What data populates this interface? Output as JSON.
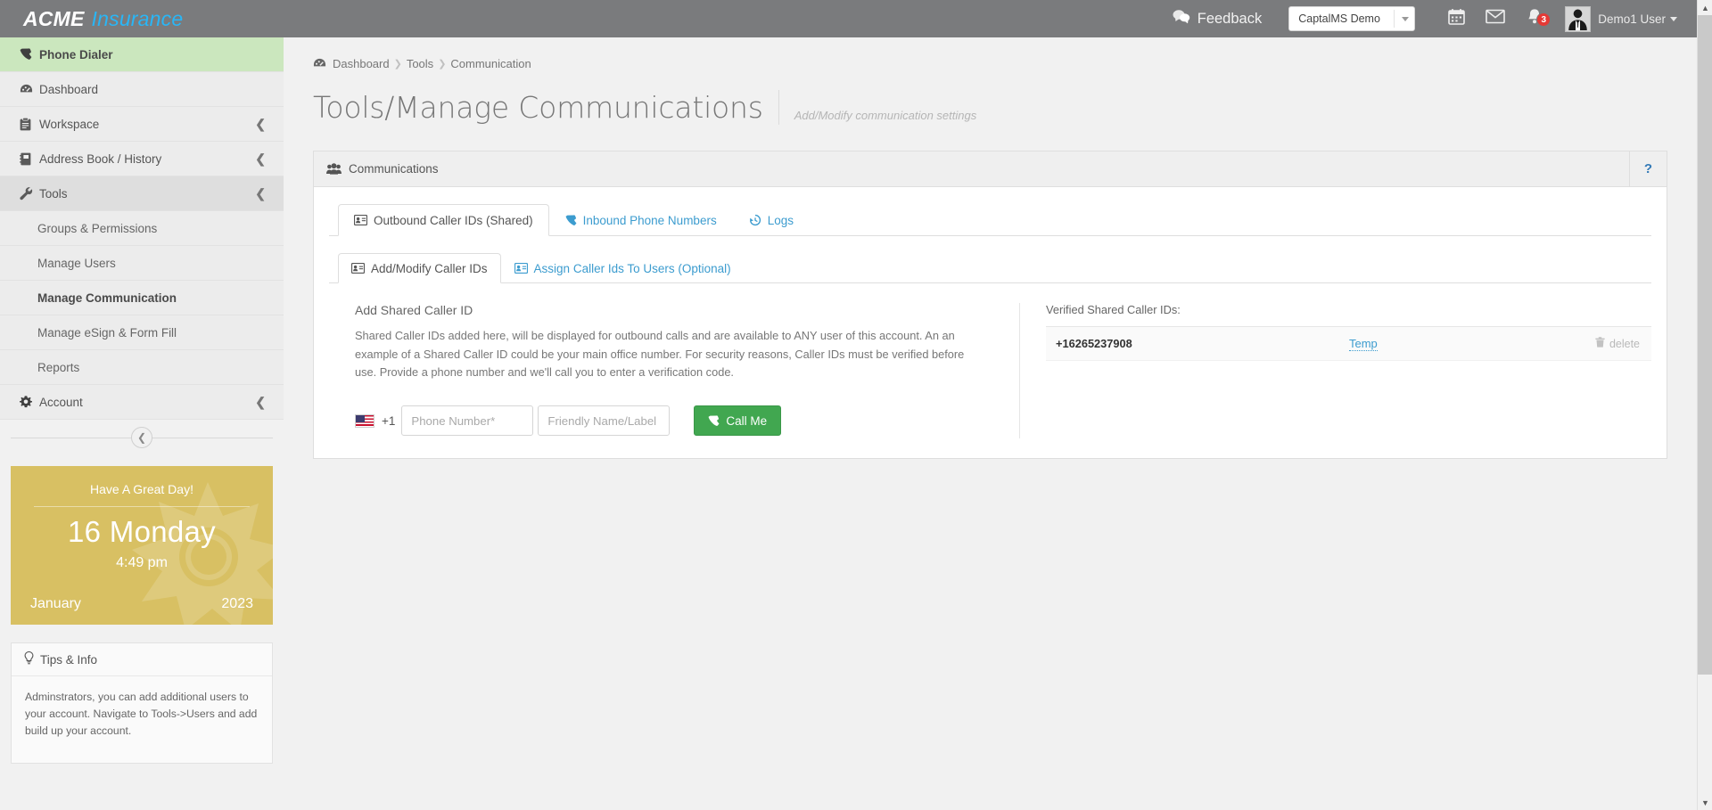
{
  "brand": {
    "name": "ACME",
    "suffix": "Insurance"
  },
  "topbar": {
    "feedback_label": "Feedback",
    "account_select_value": "CaptalMS Demo",
    "calendar_icon": "calendar-icon",
    "mail_icon": "envelope-icon",
    "bell_icon": "bell-icon",
    "notification_count": "3",
    "username": "Demo1 User"
  },
  "sidebar": {
    "items": [
      {
        "label": "Phone Dialer",
        "icon": "phone-icon",
        "state": "active"
      },
      {
        "label": "Dashboard",
        "icon": "dashboard-icon",
        "state": "normal"
      },
      {
        "label": "Workspace",
        "icon": "clipboard-icon",
        "state": "collapsible"
      },
      {
        "label": "Address Book / History",
        "icon": "book-icon",
        "state": "collapsible"
      },
      {
        "label": "Tools",
        "icon": "wrench-icon",
        "state": "open"
      }
    ],
    "tools_children": [
      {
        "label": "Groups & Permissions",
        "current": false
      },
      {
        "label": "Manage Users",
        "current": false
      },
      {
        "label": "Manage Communication",
        "current": true
      },
      {
        "label": "Manage eSign & Form Fill",
        "current": false
      },
      {
        "label": "Reports",
        "current": false
      }
    ],
    "account_item": {
      "label": "Account",
      "icon": "gear-icon"
    },
    "collapse_icon": "chevron-left-icon"
  },
  "date_widget": {
    "greeting": "Have A Great Day!",
    "day": "16 Monday",
    "time": "4:49 pm",
    "month": "January",
    "year": "2023",
    "bg_color": "#d8c063"
  },
  "tips": {
    "title": "Tips & Info",
    "icon": "lightbulb-icon",
    "body": "Adminstrators, you can add additional users to your account. Navigate to Tools->Users and add build up your account."
  },
  "breadcrumb": {
    "icon": "dashboard-icon",
    "items": [
      "Dashboard",
      "Tools",
      "Communication"
    ]
  },
  "page": {
    "title": "Tools/Manage Communications",
    "subtitle": "Add/Modify communication settings"
  },
  "panel": {
    "title": "Communications",
    "icon": "users-icon",
    "help_label": "?"
  },
  "tabs": [
    {
      "label": "Outbound Caller IDs (Shared)",
      "icon": "id-card-icon",
      "selected": true
    },
    {
      "label": "Inbound Phone Numbers",
      "icon": "phone-icon",
      "selected": false
    },
    {
      "label": "Logs",
      "icon": "history-icon",
      "selected": false
    }
  ],
  "subtabs": [
    {
      "label": "Add/Modify Caller IDs",
      "icon": "id-card-icon",
      "selected": true
    },
    {
      "label": "Assign Caller Ids To Users (Optional)",
      "icon": "id-card-icon",
      "selected": false
    }
  ],
  "form": {
    "section_title": "Add Shared Caller ID",
    "description": "Shared Caller IDs added here, will be displayed for outbound calls and are available to ANY user of this account. An an example of a Shared Caller ID could be your main office number. For security reasons, Caller IDs must be verified before use. Provide a phone number and we'll call you to enter a verification code.",
    "country_flag": "us-flag-icon",
    "country_code": "+1",
    "phone_placeholder": "Phone Number*",
    "phone_value": "",
    "label_placeholder": "Friendly Name/Label",
    "label_value": "",
    "call_button": "Call Me",
    "call_button_icon": "phone-icon",
    "call_button_color": "#41a750"
  },
  "verified": {
    "title": "Verified Shared Caller IDs:",
    "rows": [
      {
        "number": "+16265237908",
        "name": "Temp",
        "delete_label": "delete",
        "delete_icon": "trash-icon"
      }
    ]
  },
  "scrollbar": {
    "up_icon": "chevron-up-icon",
    "down_icon": "chevron-down-icon"
  }
}
